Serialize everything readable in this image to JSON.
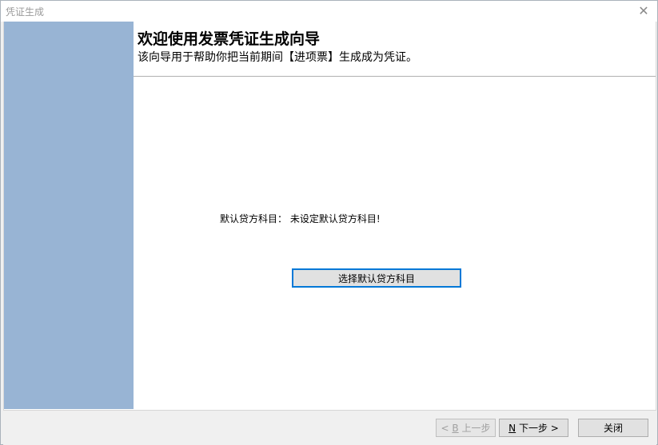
{
  "window": {
    "title": "凭证生成",
    "close_glyph": "✕"
  },
  "header": {
    "title": "欢迎使用发票凭证生成向导",
    "subtitle": "该向导用于帮助你把当前期间【进项票】生成成为凭证。"
  },
  "content": {
    "default_credit_label": "默认贷方科目：",
    "default_credit_value": "未设定默认贷方科目!",
    "select_button_label": "选择默认贷方科目"
  },
  "footer": {
    "prev": {
      "pre": "< ",
      "mnemonic": "B",
      "post": " 上一步",
      "disabled": true
    },
    "next": {
      "mnemonic": "N",
      "post": " 下一步 >"
    },
    "close_label": "关闭"
  },
  "colors": {
    "side_panel": "#98b4d4",
    "focus_border": "#0078d7"
  }
}
